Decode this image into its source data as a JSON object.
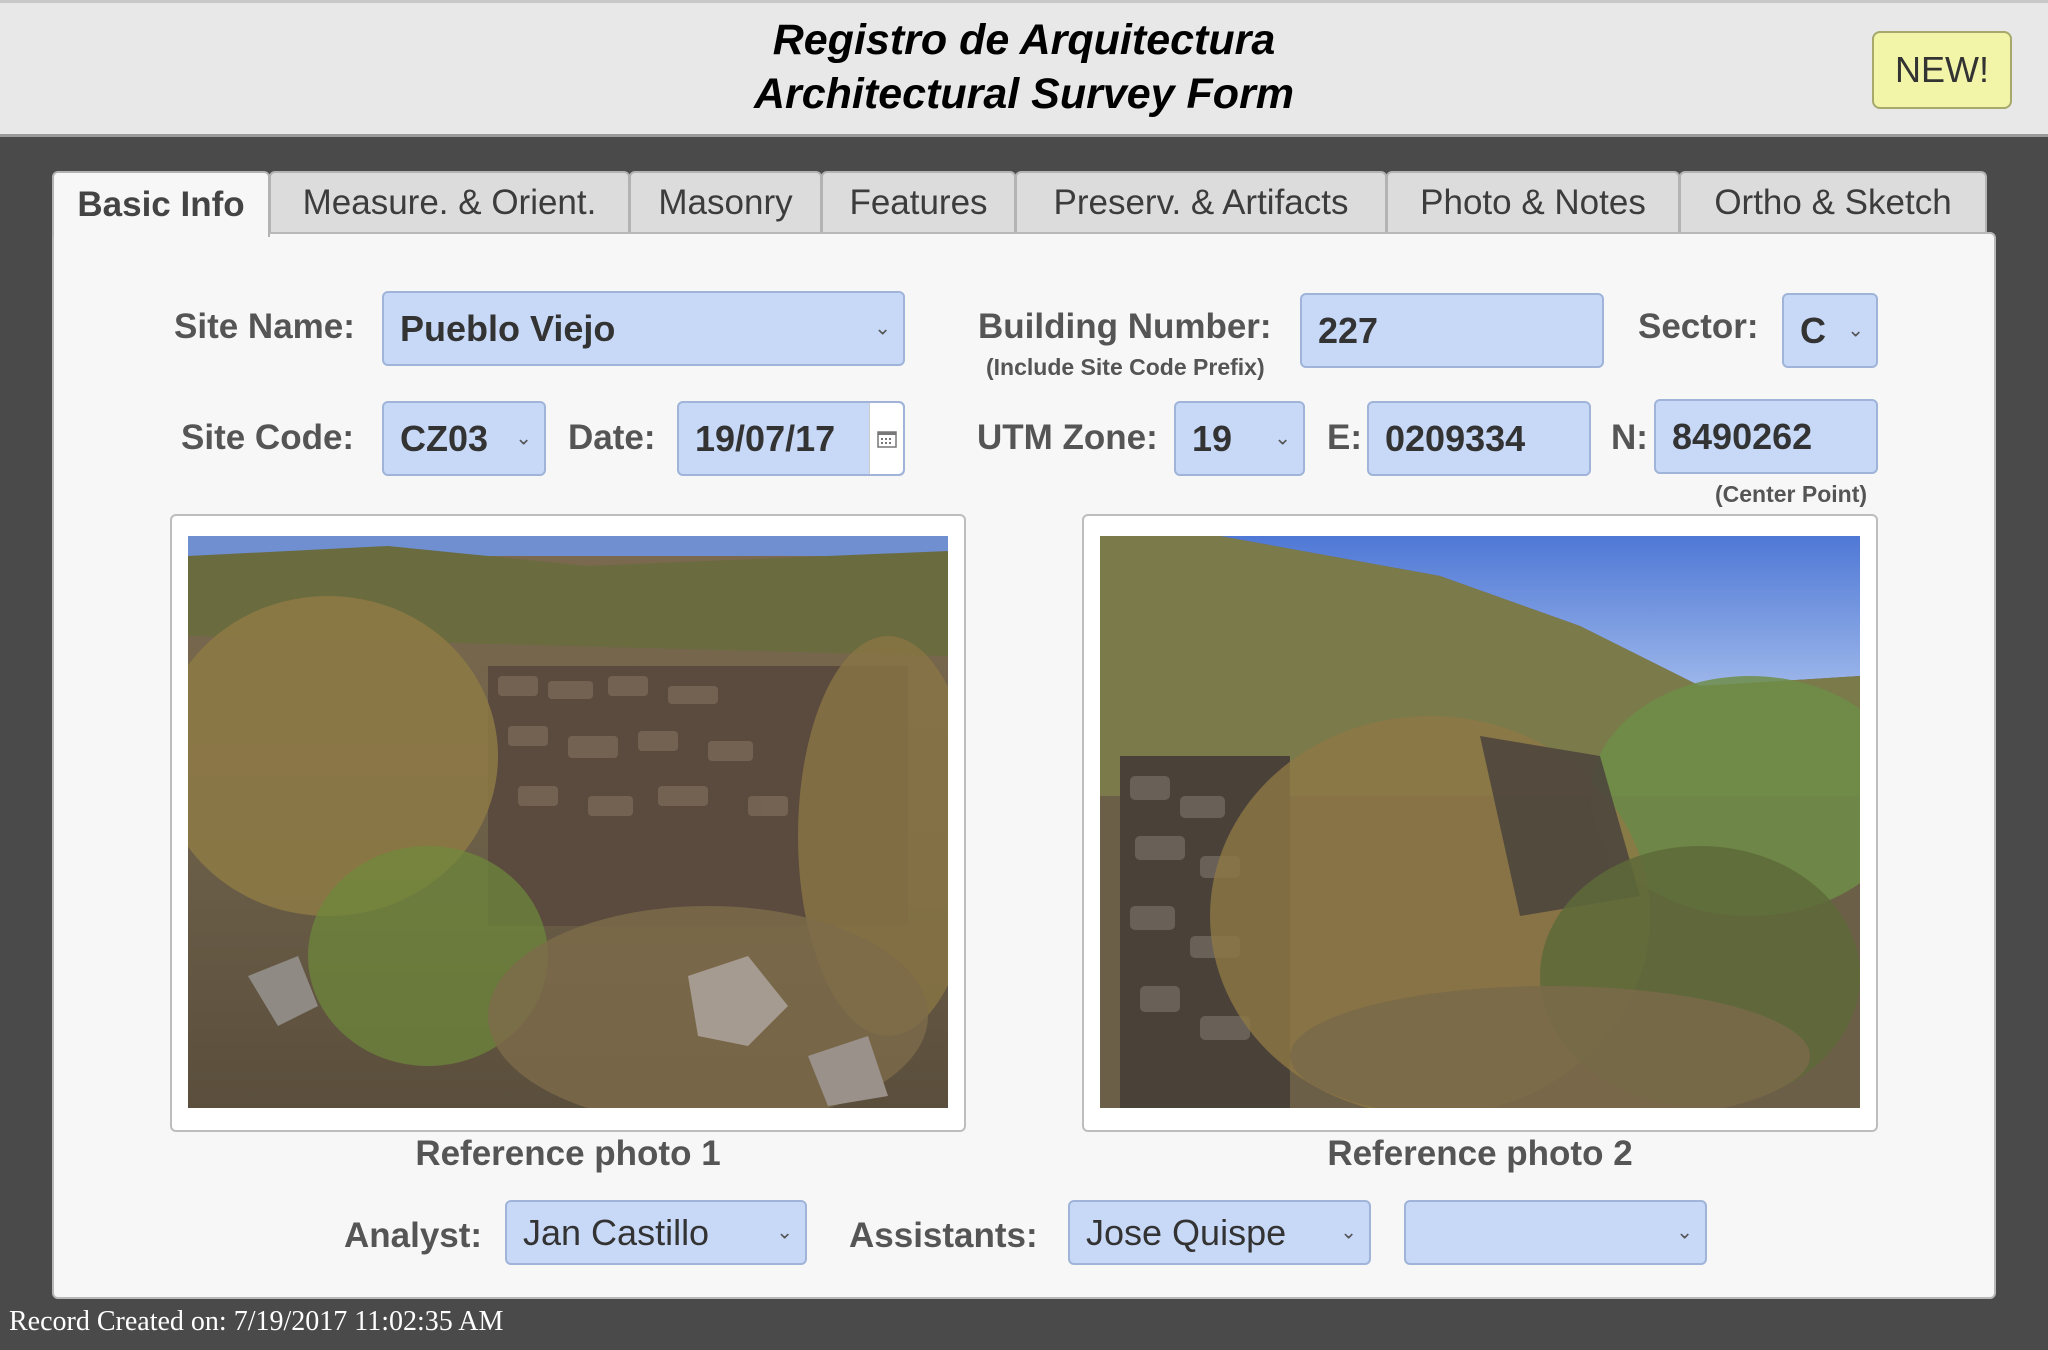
{
  "header": {
    "title_es": "Registro de Arquitectura",
    "title_en": "Architectural Survey Form",
    "new_button": "NEW!"
  },
  "tabs": [
    {
      "label": "Basic Info",
      "active": true
    },
    {
      "label": "Measure. & Orient."
    },
    {
      "label": "Masonry"
    },
    {
      "label": "Features"
    },
    {
      "label": "Preserv. & Artifacts"
    },
    {
      "label": "Photo & Notes"
    },
    {
      "label": "Ortho & Sketch"
    }
  ],
  "form": {
    "site_name_label": "Site Name:",
    "site_name_value": "Pueblo Viejo",
    "building_number_label": "Building Number:",
    "building_number_hint": "(Include Site Code Prefix)",
    "building_number_value": "227",
    "sector_label": "Sector:",
    "sector_value": "C",
    "site_code_label": "Site Code:",
    "site_code_value": "CZ03",
    "date_label": "Date:",
    "date_value": "19/07/17",
    "utm_zone_label": "UTM Zone:",
    "utm_zone_value": "19",
    "easting_label": "E:",
    "easting_value": "0209334",
    "northing_label": "N:",
    "northing_value": "8490262",
    "center_point_hint": "(Center Point)",
    "analyst_label": "Analyst:",
    "analyst_value": "Jan Castillo",
    "assistants_label": "Assistants:",
    "assistant1_value": "Jose Quispe",
    "assistant2_value": ""
  },
  "photos": {
    "caption1": "Reference photo 1",
    "caption2": "Reference photo 2"
  },
  "footer": {
    "record_created": "Record Created on: 7/19/2017 11:02:35 AM"
  },
  "icons": {
    "dropdown": "chevron-down-icon",
    "calendar": "calendar-icon"
  },
  "colors": {
    "field_bg": "#c8d9f8",
    "new_button_bg": "#f2f5a8",
    "page_bg": "#4a4a4a"
  }
}
